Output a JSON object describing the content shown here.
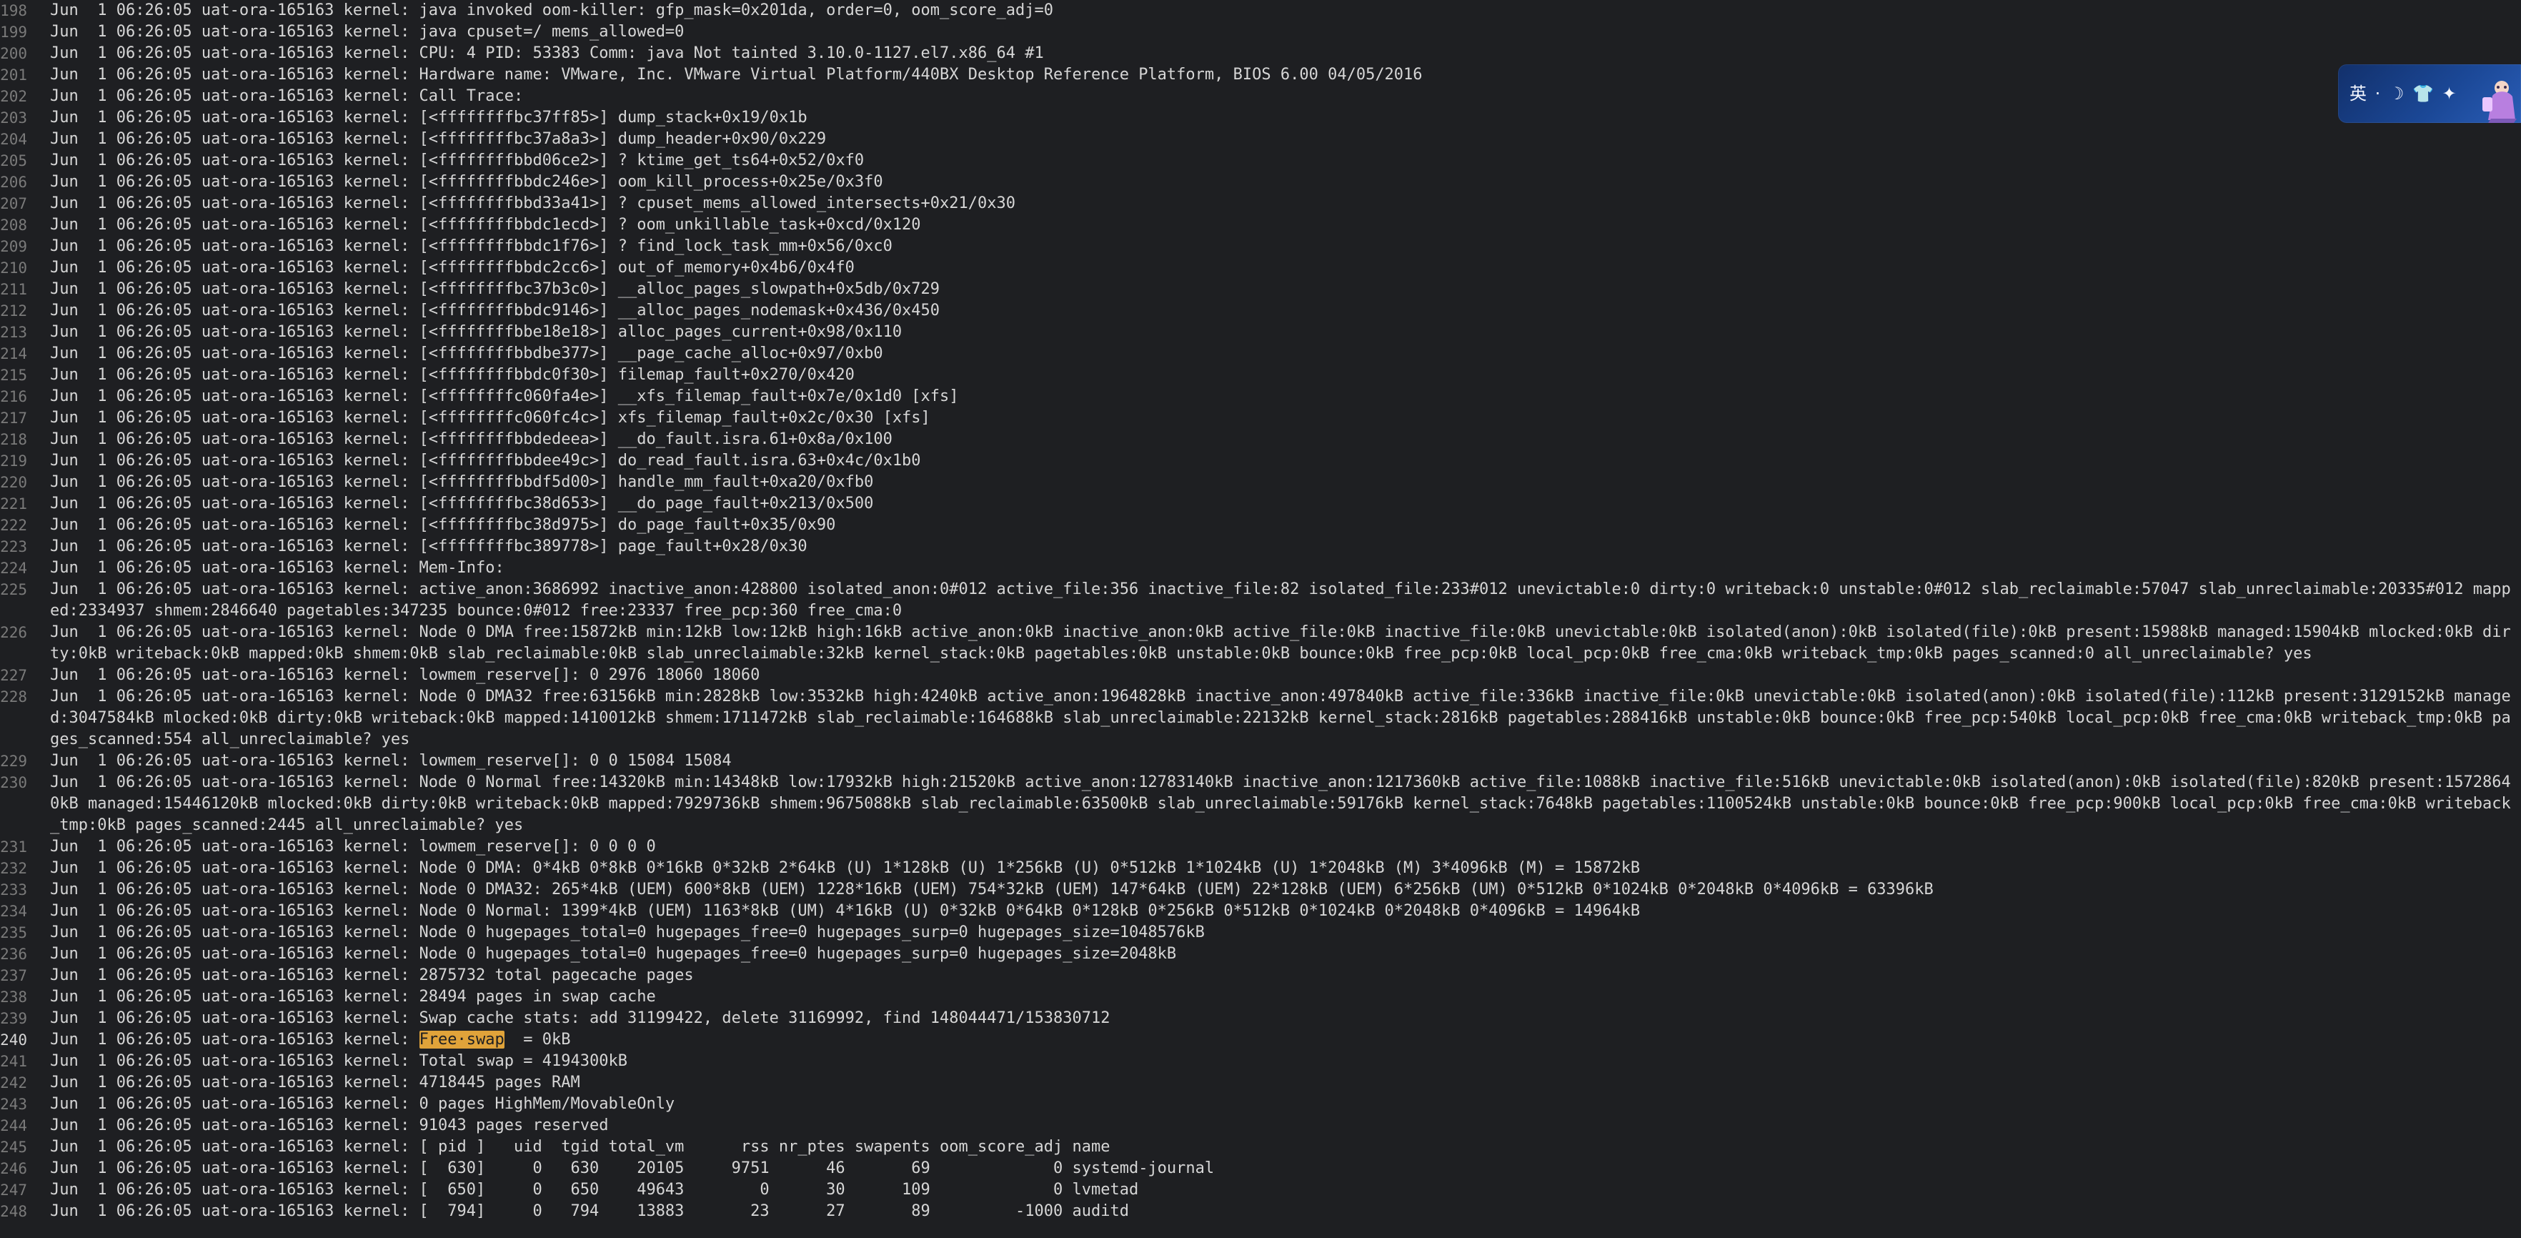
{
  "editor": {
    "current_line_index": 42,
    "highlight": {
      "line_index": 42,
      "before": "Jun  1 06:26:05 uat-ora-165163 kernel: ",
      "text": "Free·swap",
      "after": "  = 0kB"
    },
    "lines": [
      {
        "number": "198",
        "text": "Jun  1 06:26:05 uat-ora-165163 kernel: java invoked oom-killer: gfp_mask=0x201da, order=0, oom_score_adj=0"
      },
      {
        "number": "199",
        "text": "Jun  1 06:26:05 uat-ora-165163 kernel: java cpuset=/ mems_allowed=0"
      },
      {
        "number": "200",
        "text": "Jun  1 06:26:05 uat-ora-165163 kernel: CPU: 4 PID: 53383 Comm: java Not tainted 3.10.0-1127.el7.x86_64 #1"
      },
      {
        "number": "201",
        "text": "Jun  1 06:26:05 uat-ora-165163 kernel: Hardware name: VMware, Inc. VMware Virtual Platform/440BX Desktop Reference Platform, BIOS 6.00 04/05/2016"
      },
      {
        "number": "202",
        "text": "Jun  1 06:26:05 uat-ora-165163 kernel: Call Trace:"
      },
      {
        "number": "203",
        "text": "Jun  1 06:26:05 uat-ora-165163 kernel: [<ffffffffbc37ff85>] dump_stack+0x19/0x1b"
      },
      {
        "number": "204",
        "text": "Jun  1 06:26:05 uat-ora-165163 kernel: [<ffffffffbc37a8a3>] dump_header+0x90/0x229"
      },
      {
        "number": "205",
        "text": "Jun  1 06:26:05 uat-ora-165163 kernel: [<ffffffffbbd06ce2>] ? ktime_get_ts64+0x52/0xf0"
      },
      {
        "number": "206",
        "text": "Jun  1 06:26:05 uat-ora-165163 kernel: [<ffffffffbbdc246e>] oom_kill_process+0x25e/0x3f0"
      },
      {
        "number": "207",
        "text": "Jun  1 06:26:05 uat-ora-165163 kernel: [<ffffffffbbd33a41>] ? cpuset_mems_allowed_intersects+0x21/0x30"
      },
      {
        "number": "208",
        "text": "Jun  1 06:26:05 uat-ora-165163 kernel: [<ffffffffbbdc1ecd>] ? oom_unkillable_task+0xcd/0x120"
      },
      {
        "number": "209",
        "text": "Jun  1 06:26:05 uat-ora-165163 kernel: [<ffffffffbbdc1f76>] ? find_lock_task_mm+0x56/0xc0"
      },
      {
        "number": "210",
        "text": "Jun  1 06:26:05 uat-ora-165163 kernel: [<ffffffffbbdc2cc6>] out_of_memory+0x4b6/0x4f0"
      },
      {
        "number": "211",
        "text": "Jun  1 06:26:05 uat-ora-165163 kernel: [<ffffffffbc37b3c0>] __alloc_pages_slowpath+0x5db/0x729"
      },
      {
        "number": "212",
        "text": "Jun  1 06:26:05 uat-ora-165163 kernel: [<ffffffffbbdc9146>] __alloc_pages_nodemask+0x436/0x450"
      },
      {
        "number": "213",
        "text": "Jun  1 06:26:05 uat-ora-165163 kernel: [<ffffffffbbe18e18>] alloc_pages_current+0x98/0x110"
      },
      {
        "number": "214",
        "text": "Jun  1 06:26:05 uat-ora-165163 kernel: [<ffffffffbbdbe377>] __page_cache_alloc+0x97/0xb0"
      },
      {
        "number": "215",
        "text": "Jun  1 06:26:05 uat-ora-165163 kernel: [<ffffffffbbdc0f30>] filemap_fault+0x270/0x420"
      },
      {
        "number": "216",
        "text": "Jun  1 06:26:05 uat-ora-165163 kernel: [<ffffffffc060fa4e>] __xfs_filemap_fault+0x7e/0x1d0 [xfs]"
      },
      {
        "number": "217",
        "text": "Jun  1 06:26:05 uat-ora-165163 kernel: [<ffffffffc060fc4c>] xfs_filemap_fault+0x2c/0x30 [xfs]"
      },
      {
        "number": "218",
        "text": "Jun  1 06:26:05 uat-ora-165163 kernel: [<ffffffffbbdedeea>] __do_fault.isra.61+0x8a/0x100"
      },
      {
        "number": "219",
        "text": "Jun  1 06:26:05 uat-ora-165163 kernel: [<ffffffffbbdee49c>] do_read_fault.isra.63+0x4c/0x1b0"
      },
      {
        "number": "220",
        "text": "Jun  1 06:26:05 uat-ora-165163 kernel: [<ffffffffbbdf5d00>] handle_mm_fault+0xa20/0xfb0"
      },
      {
        "number": "221",
        "text": "Jun  1 06:26:05 uat-ora-165163 kernel: [<ffffffffbc38d653>] __do_page_fault+0x213/0x500"
      },
      {
        "number": "222",
        "text": "Jun  1 06:26:05 uat-ora-165163 kernel: [<ffffffffbc38d975>] do_page_fault+0x35/0x90"
      },
      {
        "number": "223",
        "text": "Jun  1 06:26:05 uat-ora-165163 kernel: [<ffffffffbc389778>] page_fault+0x28/0x30"
      },
      {
        "number": "224",
        "text": "Jun  1 06:26:05 uat-ora-165163 kernel: Mem-Info:"
      },
      {
        "number": "225",
        "text": "Jun  1 06:26:05 uat-ora-165163 kernel: active_anon:3686992 inactive_anon:428800 isolated_anon:0#012 active_file:356 inactive_file:82 isolated_file:233#012 unevictable:0 dirty:0 writeback:0 unstable:0#012 slab_reclaimable:57047 slab_unreclaimable:20335#012 mapped:2334937 shmem:2846640 pagetables:347235 bounce:0#012 free:23337 free_pcp:360 free_cma:0"
      },
      {
        "number": "226",
        "text": "Jun  1 06:26:05 uat-ora-165163 kernel: Node 0 DMA free:15872kB min:12kB low:12kB high:16kB active_anon:0kB inactive_anon:0kB active_file:0kB inactive_file:0kB unevictable:0kB isolated(anon):0kB isolated(file):0kB present:15988kB managed:15904kB mlocked:0kB dirty:0kB writeback:0kB mapped:0kB shmem:0kB slab_reclaimable:0kB slab_unreclaimable:32kB kernel_stack:0kB pagetables:0kB unstable:0kB bounce:0kB free_pcp:0kB local_pcp:0kB free_cma:0kB writeback_tmp:0kB pages_scanned:0 all_unreclaimable? yes"
      },
      {
        "number": "227",
        "text": "Jun  1 06:26:05 uat-ora-165163 kernel: lowmem_reserve[]: 0 2976 18060 18060"
      },
      {
        "number": "228",
        "text": "Jun  1 06:26:05 uat-ora-165163 kernel: Node 0 DMA32 free:63156kB min:2828kB low:3532kB high:4240kB active_anon:1964828kB inactive_anon:497840kB active_file:336kB inactive_file:0kB unevictable:0kB isolated(anon):0kB isolated(file):112kB present:3129152kB managed:3047584kB mlocked:0kB dirty:0kB writeback:0kB mapped:1410012kB shmem:1711472kB slab_reclaimable:164688kB slab_unreclaimable:22132kB kernel_stack:2816kB pagetables:288416kB unstable:0kB bounce:0kB free_pcp:540kB local_pcp:0kB free_cma:0kB writeback_tmp:0kB pages_scanned:554 all_unreclaimable? yes"
      },
      {
        "number": "229",
        "text": "Jun  1 06:26:05 uat-ora-165163 kernel: lowmem_reserve[]: 0 0 15084 15084"
      },
      {
        "number": "230",
        "text": "Jun  1 06:26:05 uat-ora-165163 kernel: Node 0 Normal free:14320kB min:14348kB low:17932kB high:21520kB active_anon:12783140kB inactive_anon:1217360kB active_file:1088kB inactive_file:516kB unevictable:0kB isolated(anon):0kB isolated(file):820kB present:15728640kB managed:15446120kB mlocked:0kB dirty:0kB writeback:0kB mapped:7929736kB shmem:9675088kB slab_reclaimable:63500kB slab_unreclaimable:59176kB kernel_stack:7648kB pagetables:1100524kB unstable:0kB bounce:0kB free_pcp:900kB local_pcp:0kB free_cma:0kB writeback_tmp:0kB pages_scanned:2445 all_unreclaimable? yes"
      },
      {
        "number": "231",
        "text": "Jun  1 06:26:05 uat-ora-165163 kernel: lowmem_reserve[]: 0 0 0 0"
      },
      {
        "number": "232",
        "text": "Jun  1 06:26:05 uat-ora-165163 kernel: Node 0 DMA: 0*4kB 0*8kB 0*16kB 0*32kB 2*64kB (U) 1*128kB (U) 1*256kB (U) 0*512kB 1*1024kB (U) 1*2048kB (M) 3*4096kB (M) = 15872kB"
      },
      {
        "number": "233",
        "text": "Jun  1 06:26:05 uat-ora-165163 kernel: Node 0 DMA32: 265*4kB (UEM) 600*8kB (UEM) 1228*16kB (UEM) 754*32kB (UEM) 147*64kB (UEM) 22*128kB (UEM) 6*256kB (UM) 0*512kB 0*1024kB 0*2048kB 0*4096kB = 63396kB"
      },
      {
        "number": "234",
        "text": "Jun  1 06:26:05 uat-ora-165163 kernel: Node 0 Normal: 1399*4kB (UEM) 1163*8kB (UM) 4*16kB (U) 0*32kB 0*64kB 0*128kB 0*256kB 0*512kB 0*1024kB 0*2048kB 0*4096kB = 14964kB"
      },
      {
        "number": "235",
        "text": "Jun  1 06:26:05 uat-ora-165163 kernel: Node 0 hugepages_total=0 hugepages_free=0 hugepages_surp=0 hugepages_size=1048576kB"
      },
      {
        "number": "236",
        "text": "Jun  1 06:26:05 uat-ora-165163 kernel: Node 0 hugepages_total=0 hugepages_free=0 hugepages_surp=0 hugepages_size=2048kB"
      },
      {
        "number": "237",
        "text": "Jun  1 06:26:05 uat-ora-165163 kernel: 2875732 total pagecache pages"
      },
      {
        "number": "238",
        "text": "Jun  1 06:26:05 uat-ora-165163 kernel: 28494 pages in swap cache"
      },
      {
        "number": "239",
        "text": "Jun  1 06:26:05 uat-ora-165163 kernel: Swap cache stats: add 31199422, delete 31169992, find 148044471/153830712"
      },
      {
        "number": "240",
        "text": ""
      },
      {
        "number": "241",
        "text": "Jun  1 06:26:05 uat-ora-165163 kernel: Total swap = 4194300kB"
      },
      {
        "number": "242",
        "text": "Jun  1 06:26:05 uat-ora-165163 kernel: 4718445 pages RAM"
      },
      {
        "number": "243",
        "text": "Jun  1 06:26:05 uat-ora-165163 kernel: 0 pages HighMem/MovableOnly"
      },
      {
        "number": "244",
        "text": "Jun  1 06:26:05 uat-ora-165163 kernel: 91043 pages reserved"
      },
      {
        "number": "245",
        "text": "Jun  1 06:26:05 uat-ora-165163 kernel: [ pid ]   uid  tgid total_vm      rss nr_ptes swapents oom_score_adj name"
      },
      {
        "number": "246",
        "text": "Jun  1 06:26:05 uat-ora-165163 kernel: [  630]     0   630    20105     9751      46       69             0 systemd-journal"
      },
      {
        "number": "247",
        "text": "Jun  1 06:26:05 uat-ora-165163 kernel: [  650]     0   650    49643        0      30      109             0 lvmetad"
      },
      {
        "number": "248",
        "text": "Jun  1 06:26:05 uat-ora-165163 kernel: [  794]     0   794    13883       23      27       89         -1000 auditd"
      }
    ]
  },
  "ime_widget": {
    "label": "英 · ☽ 👕 ✦"
  }
}
